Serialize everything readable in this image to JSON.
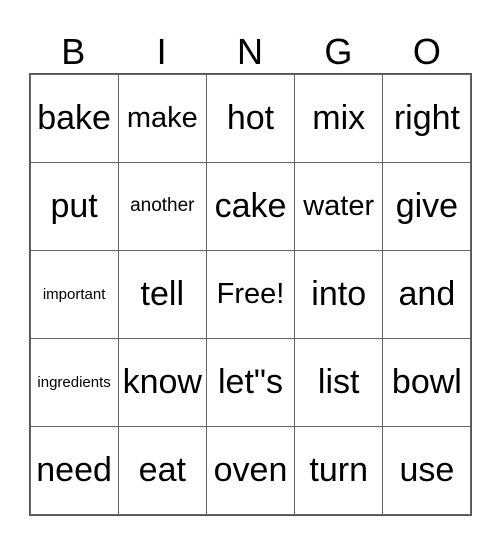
{
  "header": [
    "B",
    "I",
    "N",
    "G",
    "O"
  ],
  "cells": [
    [
      {
        "text": "bake",
        "size": "lg"
      },
      {
        "text": "make",
        "size": "md"
      },
      {
        "text": "hot",
        "size": "lg"
      },
      {
        "text": "mix",
        "size": "lg"
      },
      {
        "text": "right",
        "size": "lg"
      }
    ],
    [
      {
        "text": "put",
        "size": "lg"
      },
      {
        "text": "another",
        "size": "sm"
      },
      {
        "text": "cake",
        "size": "lg"
      },
      {
        "text": "water",
        "size": "md"
      },
      {
        "text": "give",
        "size": "lg"
      }
    ],
    [
      {
        "text": "important",
        "size": "xs"
      },
      {
        "text": "tell",
        "size": "lg"
      },
      {
        "text": "Free!",
        "size": "md"
      },
      {
        "text": "into",
        "size": "lg"
      },
      {
        "text": "and",
        "size": "lg"
      }
    ],
    [
      {
        "text": "ingredients",
        "size": "xs"
      },
      {
        "text": "know",
        "size": "lg"
      },
      {
        "text": "let\"s",
        "size": "lg"
      },
      {
        "text": "list",
        "size": "lg"
      },
      {
        "text": "bowl",
        "size": "lg"
      }
    ],
    [
      {
        "text": "need",
        "size": "lg"
      },
      {
        "text": "eat",
        "size": "lg"
      },
      {
        "text": "oven",
        "size": "lg"
      },
      {
        "text": "turn",
        "size": "lg"
      },
      {
        "text": "use",
        "size": "lg"
      }
    ]
  ]
}
